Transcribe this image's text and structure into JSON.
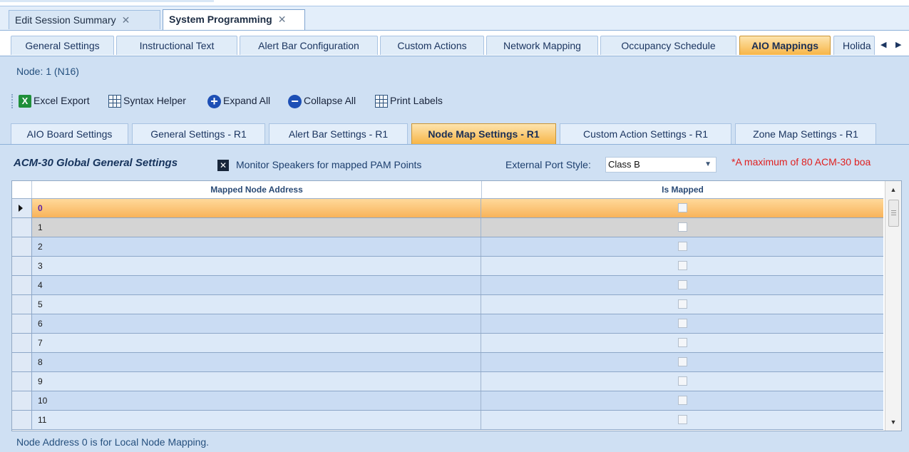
{
  "doc_tabs": [
    {
      "label": "Edit Session Summary",
      "close": "✕"
    },
    {
      "label": "System Programming",
      "close": "✕"
    }
  ],
  "level2_tabs": [
    "General Settings",
    "Instructional Text",
    "Alert Bar Configuration",
    "Custom Actions",
    "Network Mapping",
    "Occupancy Schedule",
    "AIO Mappings",
    "Holida"
  ],
  "level2_active": "AIO Mappings",
  "tab_nav": {
    "left": "◀",
    "right": "▶"
  },
  "node_label": "Node: 1 (N16)",
  "toolbar": {
    "excel_export": "Excel Export",
    "syntax_helper": "Syntax Helper",
    "expand_all": "Expand All",
    "collapse_all": "Collapse All",
    "print_labels": "Print Labels"
  },
  "inner_tabs": [
    "AIO Board Settings",
    "General Settings - R1",
    "Alert Bar Settings - R1",
    "Node Map Settings - R1",
    "Custom Action Settings - R1",
    "Zone Map Settings - R1"
  ],
  "inner_active": "Node Map Settings - R1",
  "settings": {
    "title": "ACM-30 Global General Settings",
    "monitor_checkbox_label": "Monitor Speakers for mapped PAM Points",
    "monitor_checked": true,
    "port_label": "External Port Style:",
    "port_value": "Class B",
    "note": "*A maximum of 80 ACM-30 boa"
  },
  "grid": {
    "columns": [
      "Mapped Node Address",
      "Is Mapped"
    ],
    "rows": [
      {
        "address": "0",
        "is_mapped": false
      },
      {
        "address": "1",
        "is_mapped": false
      },
      {
        "address": "2",
        "is_mapped": false
      },
      {
        "address": "3",
        "is_mapped": false
      },
      {
        "address": "4",
        "is_mapped": false
      },
      {
        "address": "5",
        "is_mapped": false
      },
      {
        "address": "6",
        "is_mapped": false
      },
      {
        "address": "7",
        "is_mapped": false
      },
      {
        "address": "8",
        "is_mapped": false
      },
      {
        "address": "9",
        "is_mapped": false
      },
      {
        "address": "10",
        "is_mapped": false
      },
      {
        "address": "11",
        "is_mapped": false
      }
    ]
  },
  "footer_note": "Node Address 0 is for Local Node Mapping.",
  "colors": {
    "active_tab": "#f7b547",
    "selected_row": "#f8b35a",
    "note_red": "#e02020"
  }
}
